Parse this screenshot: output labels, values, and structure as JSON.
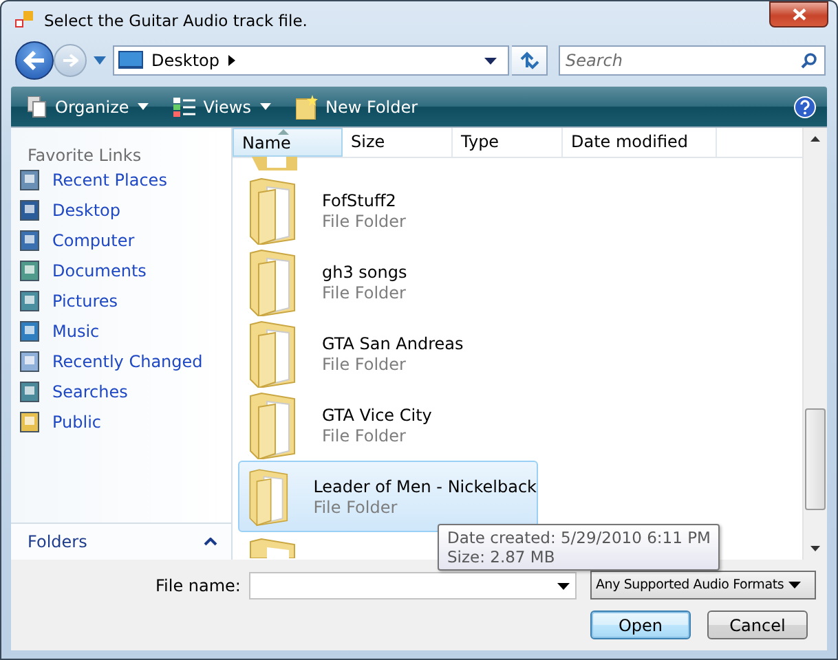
{
  "window": {
    "title": "Select the Guitar Audio track file."
  },
  "address": {
    "location": "Desktop"
  },
  "search": {
    "placeholder": "Search"
  },
  "toolbar": [
    {
      "label": "Organize",
      "kind": "menu"
    },
    {
      "label": "Views",
      "kind": "menu"
    },
    {
      "label": "New Folder",
      "kind": "plain"
    }
  ],
  "sidebar": {
    "heading": "Favorite Links",
    "items": [
      {
        "label": "Recent Places"
      },
      {
        "label": "Desktop"
      },
      {
        "label": "Computer"
      },
      {
        "label": "Documents"
      },
      {
        "label": "Pictures"
      },
      {
        "label": "Music"
      },
      {
        "label": "Recently Changed"
      },
      {
        "label": "Searches"
      },
      {
        "label": "Public"
      }
    ],
    "folders_toggle": "Folders"
  },
  "columns": [
    {
      "label": "Name",
      "sorted": true
    },
    {
      "label": "Size",
      "sorted": false
    },
    {
      "label": "Type",
      "sorted": false
    },
    {
      "label": "Date modified",
      "sorted": false
    }
  ],
  "files": [
    {
      "name": "FofStuff2",
      "type": "File Folder",
      "selected": false
    },
    {
      "name": "gh3 songs",
      "type": "File Folder",
      "selected": false
    },
    {
      "name": "GTA San Andreas",
      "type": "File Folder",
      "selected": false
    },
    {
      "name": "GTA Vice City",
      "type": "File Folder",
      "selected": false
    },
    {
      "name": "Leader of Men - Nickelback",
      "type": "File Folder",
      "selected": true
    }
  ],
  "tooltip": [
    "Date created: 5/29/2010 6:11 PM",
    "Size: 2.87 MB"
  ],
  "file_name": {
    "label": "File name:"
  },
  "filter": {
    "value": "Any Supported Audio Formats"
  },
  "buttons": [
    {
      "label": "Open",
      "default": true
    },
    {
      "label": "Cancel",
      "default": false
    }
  ]
}
